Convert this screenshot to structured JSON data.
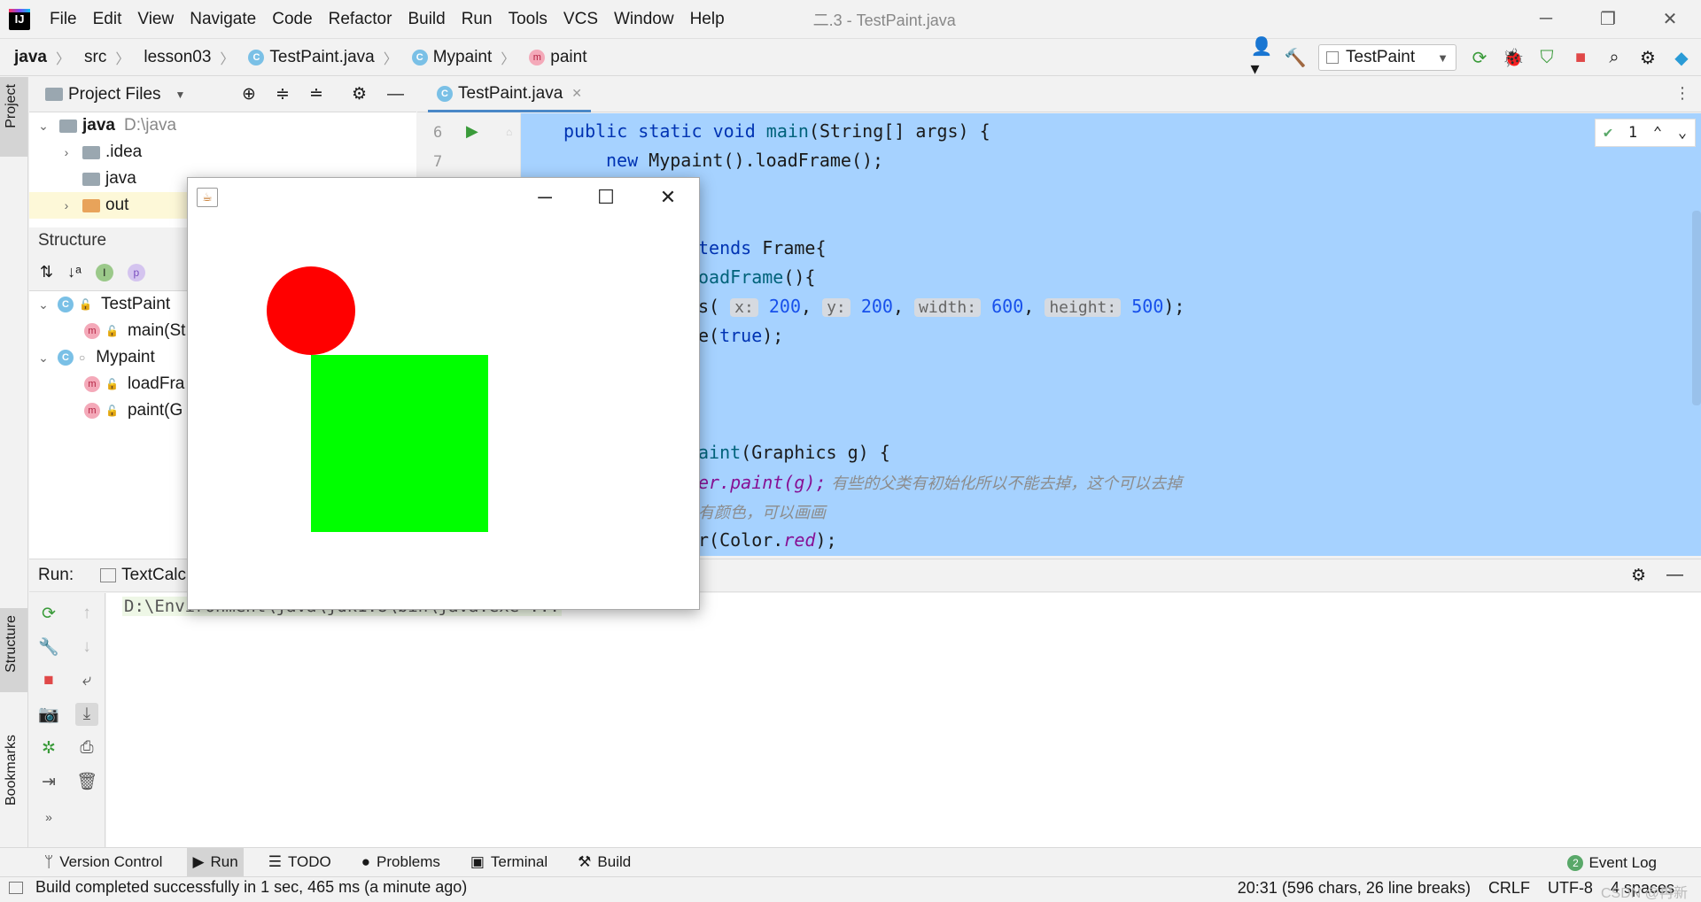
{
  "menubar": {
    "logo": "IJ",
    "items": [
      "File",
      "Edit",
      "View",
      "Navigate",
      "Code",
      "Refactor",
      "Build",
      "Run",
      "Tools",
      "VCS",
      "Window",
      "Help"
    ],
    "title": "二.3 - TestPaint.java"
  },
  "navbar": {
    "crumbs": [
      "java",
      "src",
      "lesson03",
      "TestPaint.java",
      "Mypaint",
      "paint"
    ],
    "run_config": "TestPaint"
  },
  "left_strip": {
    "project_tab": "Project",
    "structure_tab": "Structure",
    "bookmarks_tab": "Bookmarks"
  },
  "project": {
    "header": "Project Files",
    "tree": [
      {
        "name": "java",
        "path": "D:\\java"
      },
      {
        "name": ".idea"
      },
      {
        "name": "java"
      },
      {
        "name": "out"
      }
    ]
  },
  "structure": {
    "header": "Structure",
    "tree": [
      "TestPaint",
      "main(St",
      "Mypaint",
      "loadFra",
      "paint(G"
    ]
  },
  "editor": {
    "tab": "TestPaint.java",
    "line_numbers": [
      "6",
      "7"
    ],
    "inspection_count": "1",
    "code": {
      "l1_kw": "public static void ",
      "l1_fn": "main",
      "l1_rest": "(String[] args) {",
      "l2_kw": "new ",
      "l2_rest": "Mypaint().loadFrame();",
      "l3_a": "tends ",
      "l3_b": "Frame{",
      "l4_fn": "oadFrame",
      "l4_rest": "(){",
      "l5_a": "s(",
      "l5_hint_x": "x:",
      "l5_x": "200",
      "l5_hint_y": "y:",
      "l5_y": "200",
      "l5_hint_w": "width:",
      "l5_w": "600",
      "l5_hint_h": "height:",
      "l5_h": "500",
      "l5_end": ");",
      "l6_a": "e(",
      "l6_kw": "true",
      "l6_end": ");",
      "l7_fn": "aint",
      "l7_rest": "(Graphics g) {",
      "l8_a": "er.paint(g);",
      "l8_cmt": " 有些的父类有初始化所以不能去掉，这个可以去掉",
      "l9_cmt": "有颜色，可以画画",
      "l10_a": "r(Color.",
      "l10_fld": "red",
      "l10_end": ");"
    }
  },
  "run": {
    "label": "Run:",
    "config_tab": "TextCalc",
    "console": "D:\\Environment\\java\\jdk1.8\\bin\\java.exe ..."
  },
  "bottom_tabs": [
    "Version Control",
    "Run",
    "TODO",
    "Problems",
    "Terminal",
    "Build"
  ],
  "event_log": {
    "count": "2",
    "label": "Event Log"
  },
  "status": {
    "message": "Build completed successfully in 1 sec, 465 ms (a minute ago)",
    "position": "20:31 (596 chars, 26 line breaks)",
    "line_sep": "CRLF",
    "encoding": "UTF-8",
    "indent": "4 spaces",
    "watermark": "CSDN @冉新"
  },
  "java_window": {
    "shapes": {
      "circle_color": "#ff0000",
      "rect_color": "#00ff00"
    }
  },
  "colors": {
    "selection": "#a6d2ff",
    "accent": "#4a88c7"
  }
}
